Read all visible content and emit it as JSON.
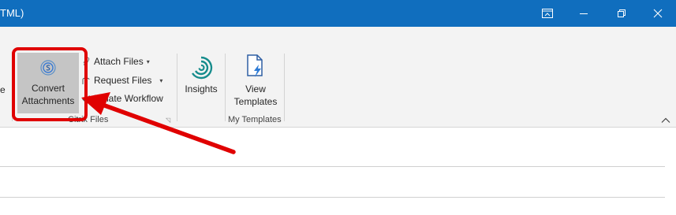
{
  "window": {
    "title_fragment": "TML)",
    "controls": [
      {
        "name": "ribbon-display-options-button",
        "icon": "ribbon-display-icon"
      },
      {
        "name": "minimize-button",
        "icon": "minimize-icon"
      },
      {
        "name": "restore-button",
        "icon": "restore-icon"
      },
      {
        "name": "close-button",
        "icon": "close-icon"
      }
    ]
  },
  "ribbon": {
    "left_cut_label": "e",
    "citrix_files": {
      "group_label": "Citrix Files",
      "convert": {
        "line1": "Convert",
        "line2": "Attachments",
        "icon": "citrix-share-icon"
      },
      "attach_files": {
        "label": "Attach Files",
        "icon": "paperclip-icon"
      },
      "request_files": {
        "label": "Request Files",
        "icon": "request-icon"
      },
      "initiate_workflow": {
        "label": "Initiate Workflow",
        "icon": "checkmark-icon"
      }
    },
    "insights": {
      "label": "Insights",
      "icon": "insights-icon"
    },
    "my_templates": {
      "group_label": "My Templates",
      "view_templates": {
        "line1": "View",
        "line2": "Templates",
        "icon": "templates-icon"
      }
    }
  },
  "colors": {
    "titlebar": "#106ebe",
    "ribbon_bg": "#f3f3f3",
    "highlight": "#e00000",
    "selected_button": "#c5c5c5"
  }
}
